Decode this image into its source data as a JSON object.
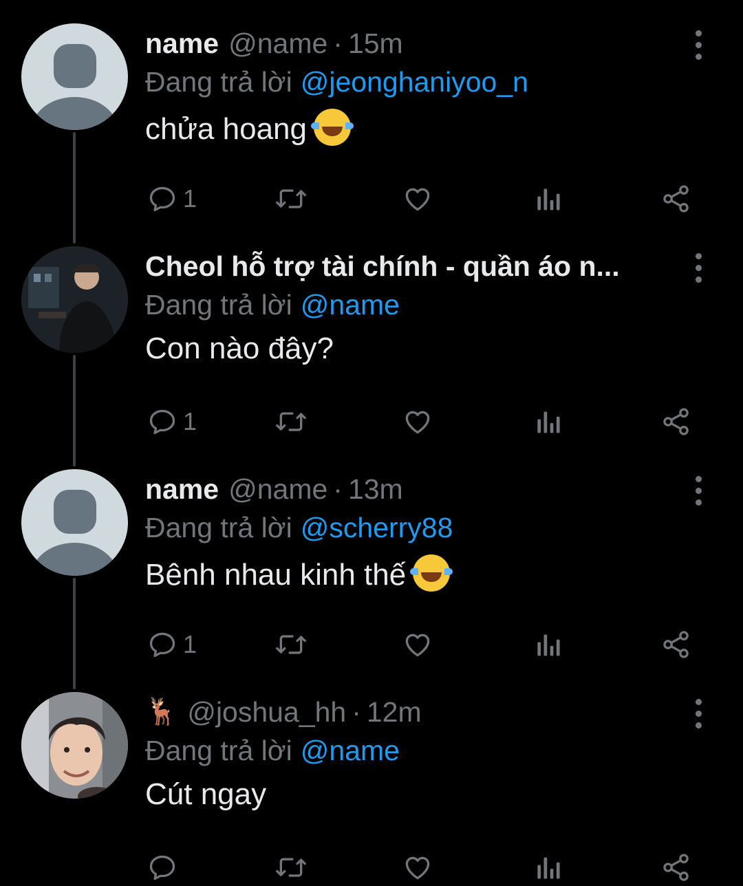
{
  "tweets": [
    {
      "avatar": "default-avatar",
      "display_name": "name",
      "handle": "@name",
      "time": "15m",
      "reply_prefix": "Đang trả lời",
      "mention": "@jeonghaniyoo_n",
      "text": "chửa hoang",
      "text_emoji": "tears-of-joy-emoji",
      "reply_count": "1"
    },
    {
      "avatar": "profile-photo",
      "display_name": "Cheol hỗ trợ tài chính - quần áo n...",
      "reply_prefix": "Đang trả lời",
      "mention": "@name",
      "text": "Con nào đây?",
      "reply_count": "1"
    },
    {
      "avatar": "default-avatar",
      "display_name": "name",
      "handle": "@name",
      "time": "13m",
      "reply_prefix": "Đang trả lời",
      "mention": "@scherry88",
      "text": "Bênh nhau kinh thế",
      "text_emoji": "tears-of-joy-emoji",
      "reply_count": "1"
    },
    {
      "avatar": "profile-photo",
      "display_name_emoji": "🦌",
      "handle": "@joshua_hh",
      "time": "12m",
      "reply_prefix": "Đang trả lời",
      "mention": "@name",
      "text": "Cút ngay",
      "reply_count": ""
    }
  ],
  "separator": "·",
  "icons": [
    "reply-icon",
    "retweet-icon",
    "like-icon",
    "analytics-icon",
    "share-icon",
    "more-options-icon"
  ],
  "colors": {
    "background": "#000000",
    "text_primary": "#e7e9ea",
    "text_secondary": "#71767b",
    "link": "#1d9bf0",
    "thread_line": "#3e4144"
  }
}
